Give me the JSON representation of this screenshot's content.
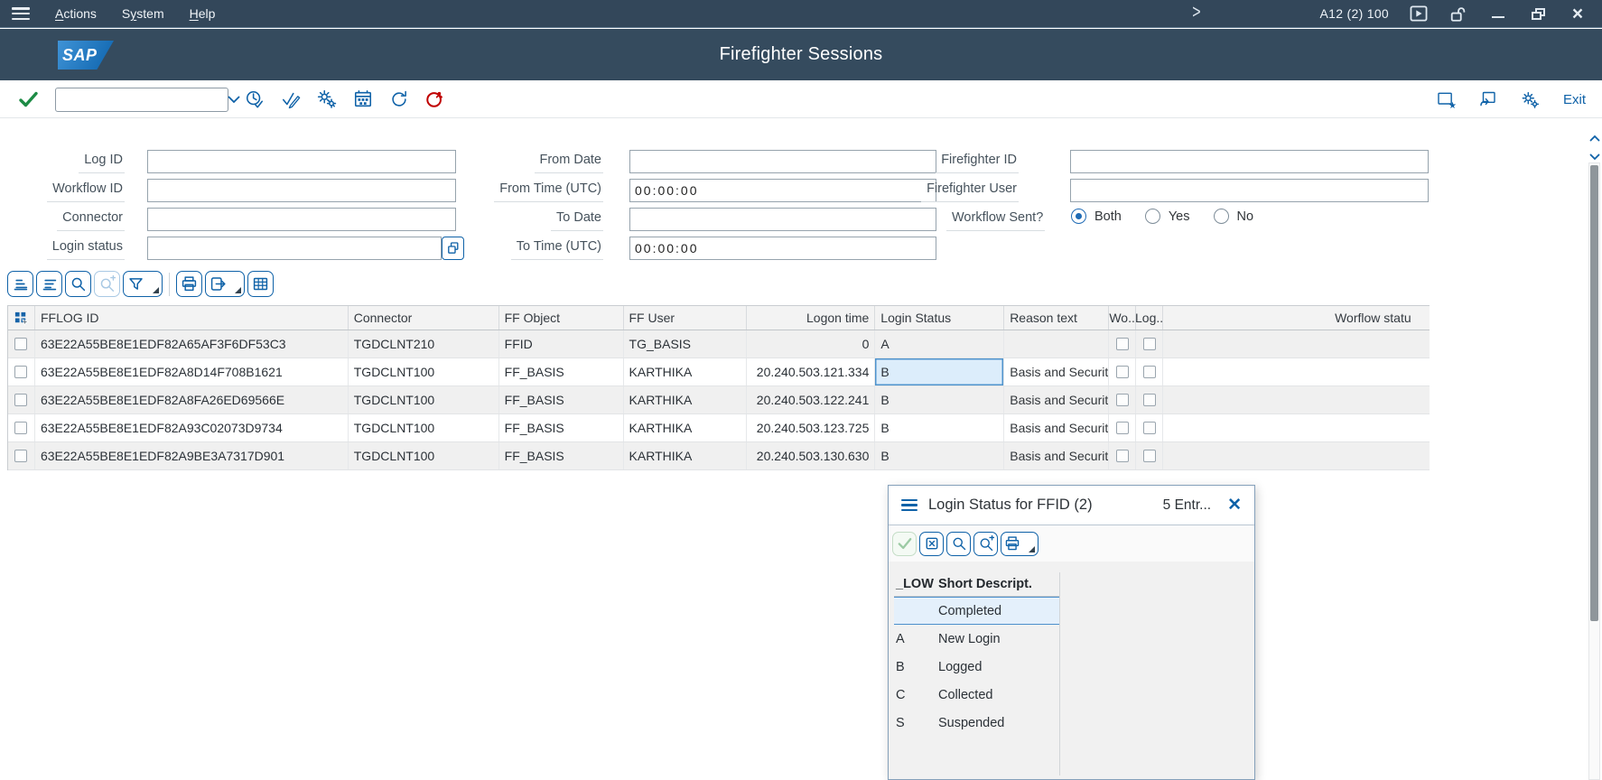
{
  "window": {
    "system_label": "A12 (2) 100"
  },
  "menubar": {
    "items": [
      {
        "label": "Actions",
        "accel": 0
      },
      {
        "label": "System",
        "accel": 1
      },
      {
        "label": "Help",
        "accel": 0
      }
    ]
  },
  "titlebar": {
    "logo": "SAP",
    "title": "Firefighter Sessions"
  },
  "toolbar": {
    "command_value": "",
    "exit_label": "Exit",
    "icons_left": [
      "enter-check",
      "command-field",
      "history-clock",
      "validate-edit",
      "settings-gears",
      "schedule-variant",
      "refresh",
      "firefighter-session"
    ],
    "icons_right": [
      "new-session-window",
      "back-window",
      "gears",
      "exit"
    ]
  },
  "form": {
    "log_id": {
      "label": "Log ID",
      "value": ""
    },
    "workflow_id": {
      "label": "Workflow ID",
      "value": ""
    },
    "connector": {
      "label": "Connector",
      "value": ""
    },
    "login_status": {
      "label": "Login status",
      "value": ""
    },
    "from_date": {
      "label": "From Date",
      "value": ""
    },
    "from_time": {
      "label": "From Time (UTC)",
      "value": "00:00:00"
    },
    "to_date": {
      "label": "To Date",
      "value": ""
    },
    "to_time": {
      "label": "To Time (UTC)",
      "value": "00:00:00"
    },
    "firefighter_id": {
      "label": "Firefighter ID",
      "value": ""
    },
    "firefighter_user": {
      "label": "Firefighter User",
      "value": ""
    },
    "workflow_sent": {
      "label": "Workflow Sent?",
      "options": [
        "Both",
        "Yes",
        "No"
      ],
      "selected": "Both"
    }
  },
  "grid_toolbar": [
    "sort-ascending",
    "sort-descending",
    "find",
    "find-next",
    "filter",
    "print",
    "export",
    "choose-layout"
  ],
  "table": {
    "columns": [
      "FFLOG ID",
      "Connector",
      "FF Object",
      "FF User",
      "Logon time",
      "Login Status",
      "Reason text",
      "Wo..",
      "Log..",
      "Worflow statu"
    ],
    "rows": [
      {
        "fflog_id": "63E22A55BE8E1EDF82A65AF3F6DF53C3",
        "connector": "TGDCLNT210",
        "ff_object": "FFID",
        "ff_user": "TG_BASIS",
        "logon_time": "0",
        "login_status": "A",
        "status_selected": false,
        "reason_text": "",
        "workflow_sent": false,
        "log_deleted": false,
        "workflow_status": ""
      },
      {
        "fflog_id": "63E22A55BE8E1EDF82A8D14F708B1621",
        "connector": "TGDCLNT100",
        "ff_object": "FF_BASIS",
        "ff_user": "KARTHIKA",
        "logon_time": "20.240.503.121.334",
        "login_status": "B",
        "status_selected": true,
        "reason_text": "Basis and Security ...",
        "workflow_sent": false,
        "log_deleted": false,
        "workflow_status": ""
      },
      {
        "fflog_id": "63E22A55BE8E1EDF82A8FA26ED69566E",
        "connector": "TGDCLNT100",
        "ff_object": "FF_BASIS",
        "ff_user": "KARTHIKA",
        "logon_time": "20.240.503.122.241",
        "login_status": "B",
        "status_selected": false,
        "reason_text": "Basis and Security ...",
        "workflow_sent": false,
        "log_deleted": false,
        "workflow_status": ""
      },
      {
        "fflog_id": "63E22A55BE8E1EDF82A93C02073D9734",
        "connector": "TGDCLNT100",
        "ff_object": "FF_BASIS",
        "ff_user": "KARTHIKA",
        "logon_time": "20.240.503.123.725",
        "login_status": "B",
        "status_selected": false,
        "reason_text": "Basis and Security ...",
        "workflow_sent": false,
        "log_deleted": false,
        "workflow_status": ""
      },
      {
        "fflog_id": "63E22A55BE8E1EDF82A9BE3A7317D901",
        "connector": "TGDCLNT100",
        "ff_object": "FF_BASIS",
        "ff_user": "KARTHIKA",
        "logon_time": "20.240.503.130.630",
        "login_status": "B",
        "status_selected": false,
        "reason_text": "Basis and Security ...",
        "workflow_sent": false,
        "log_deleted": false,
        "workflow_status": ""
      }
    ]
  },
  "popup": {
    "title": "Login Status for FFID (2)",
    "entries_label": "5 Entr...",
    "toolbar": [
      "accept-check",
      "close-box",
      "find",
      "find-next",
      "print"
    ],
    "columns": [
      "_LOW",
      "Short Descript."
    ],
    "rows": [
      {
        "low": "",
        "desc": "Completed",
        "selected": true
      },
      {
        "low": "A",
        "desc": "New Login",
        "selected": false
      },
      {
        "low": "B",
        "desc": "Logged",
        "selected": false
      },
      {
        "low": "C",
        "desc": "Collected",
        "selected": false
      },
      {
        "low": "S",
        "desc": "Suspended",
        "selected": false
      }
    ]
  },
  "colors": {
    "header_bar": "#33475a",
    "accent_blue": "#0f62a8",
    "confirm_green": "#1d8b45",
    "alert_red": "#c00000",
    "selected_cell": "#dcedfb",
    "row_stripe": "#f0f0f0"
  }
}
